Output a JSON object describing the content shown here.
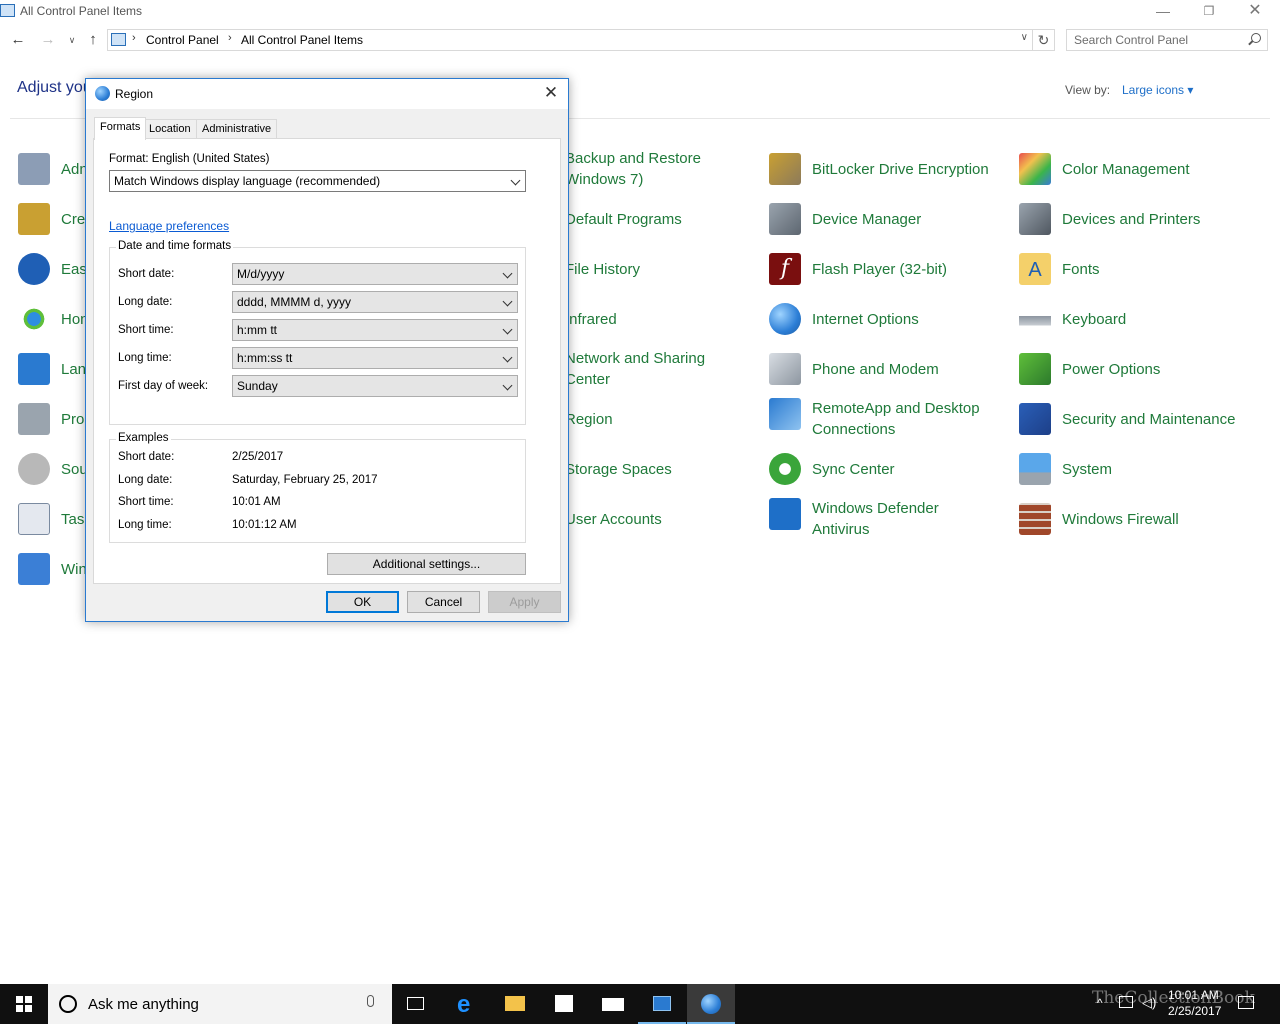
{
  "window": {
    "title": "All Control Panel Items",
    "minimize": "—",
    "restore": "❐",
    "close": "✕"
  },
  "address": {
    "crumbs": [
      "Control Panel",
      "All Control Panel Items"
    ],
    "separator": "›",
    "search_placeholder": "Search Control Panel",
    "refresh": "↻"
  },
  "nav": {
    "back": "←",
    "forward": "→",
    "recent": "∨",
    "up": "↑"
  },
  "content": {
    "heading": "Adjust you",
    "view_by_label": "View by:",
    "view_by_value": "Large icons"
  },
  "items_col1": [
    "Adn",
    "Cre",
    "Eas",
    "Hon",
    "Lan",
    "Pro",
    "Sou",
    "Task",
    "Win"
  ],
  "items_col2": [
    [
      "Backup and Restore",
      "Windows 7)"
    ],
    [
      "Default Programs"
    ],
    [
      "File History"
    ],
    [
      "Infrared"
    ],
    [
      "Network and Sharing",
      "Center"
    ],
    [
      "Region"
    ],
    [
      "Storage Spaces"
    ],
    [
      "User Accounts"
    ]
  ],
  "items_col3": [
    [
      "BitLocker Drive Encryption"
    ],
    [
      "Device Manager"
    ],
    [
      "Flash Player (32-bit)"
    ],
    [
      "Internet Options"
    ],
    [
      "Phone and Modem"
    ],
    [
      "RemoteApp and Desktop",
      "Connections"
    ],
    [
      "Sync Center"
    ],
    [
      "Windows Defender",
      "Antivirus"
    ]
  ],
  "items_col4": [
    [
      "Color Management"
    ],
    [
      "Devices and Printers"
    ],
    [
      "Fonts"
    ],
    [
      "Keyboard"
    ],
    [
      "Power Options"
    ],
    [
      "Security and Maintenance"
    ],
    [
      "System"
    ],
    [
      "Windows Firewall"
    ]
  ],
  "dialog": {
    "title": "Region",
    "close": "✕",
    "tabs": [
      "Formats",
      "Location",
      "Administrative"
    ],
    "format_label": "Format: English (United States)",
    "format_value": "Match Windows display language (recommended)",
    "language_link": "Language preferences",
    "dt_group_title": "Date and time formats",
    "dt_fields": [
      {
        "label": "Short date:",
        "value": "M/d/yyyy"
      },
      {
        "label": "Long date:",
        "value": "dddd, MMMM d, yyyy"
      },
      {
        "label": "Short time:",
        "value": "h:mm tt"
      },
      {
        "label": "Long time:",
        "value": "h:mm:ss tt"
      },
      {
        "label": "First day of week:",
        "value": "Sunday"
      }
    ],
    "examples_title": "Examples",
    "examples": [
      {
        "label": "Short date:",
        "value": "2/25/2017"
      },
      {
        "label": "Long date:",
        "value": "Saturday, February 25, 2017"
      },
      {
        "label": "Short time:",
        "value": "10:01 AM"
      },
      {
        "label": "Long time:",
        "value": "10:01:12 AM"
      }
    ],
    "additional_button": "Additional settings...",
    "ok": "OK",
    "cancel": "Cancel",
    "apply": "Apply"
  },
  "taskbar": {
    "search_placeholder": "Ask me anything",
    "time": "10:01 AM",
    "date": "2/25/2017",
    "watermark": "TheCollectionBook"
  },
  "colors": {
    "link_green": "#1f7a3a",
    "accent": "#0078d7",
    "heading_blue": "#1e3287"
  }
}
